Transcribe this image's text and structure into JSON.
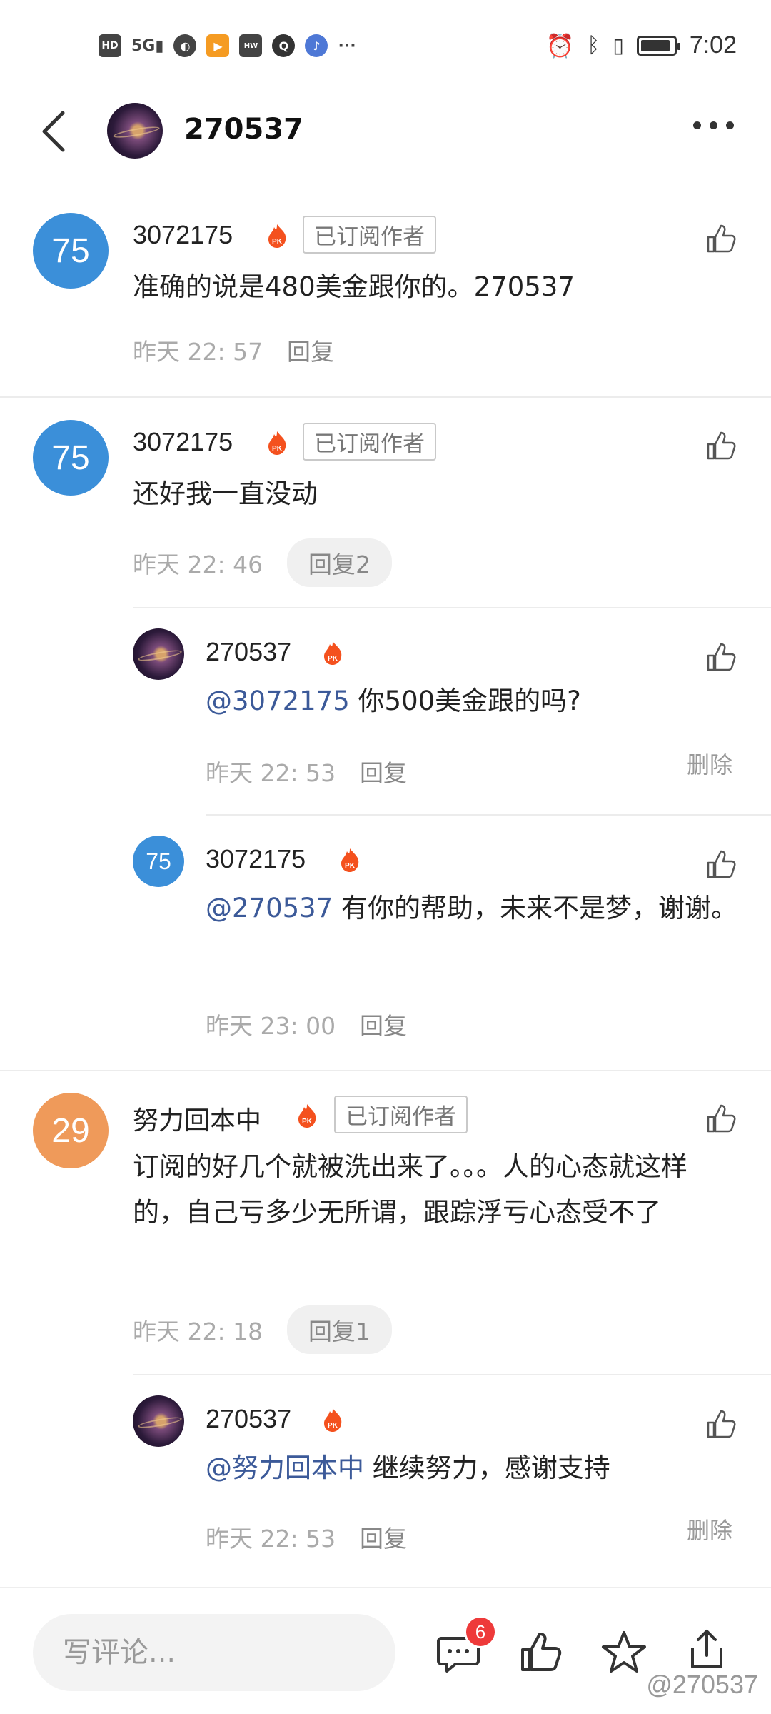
{
  "status_bar": {
    "left_icons": [
      "HD",
      "5G",
      "signal",
      "browser",
      "video",
      "huawei",
      "qq",
      "music",
      "..."
    ],
    "time": "7:02",
    "battery_level": 0.8
  },
  "header": {
    "title": "270537"
  },
  "comments": [
    {
      "avatar_label": "75",
      "avatar_color": "#3b8fd9",
      "username": "3072175",
      "badge": "已订阅作者",
      "text": "准确的说是480美金跟你的。270537",
      "time": "昨天 22: 57",
      "reply_label": "回复"
    },
    {
      "avatar_label": "75",
      "avatar_color": "#3b8fd9",
      "username": "3072175",
      "badge": "已订阅作者",
      "text": "还好我一直没动",
      "time": "昨天 22: 46",
      "reply_label": "回复2",
      "replies": [
        {
          "username": "270537",
          "mention": "@3072175",
          "text": " 你500美金跟的吗?",
          "time": "昨天 22: 53",
          "reply_label": "回复",
          "delete_label": "删除"
        },
        {
          "avatar_label": "75",
          "avatar_color": "#3b8fd9",
          "username": "3072175",
          "mention": "@270537",
          "text": " 有你的帮助，未来不是梦，谢谢。",
          "time": "昨天 23: 00",
          "reply_label": "回复"
        }
      ]
    },
    {
      "avatar_label": "29",
      "avatar_color": "#ef9a5a",
      "username": "努力回本中",
      "badge": "已订阅作者",
      "text": "订阅的好几个就被洗出来了。。。人的心态就这样的，自己亏多少无所谓，跟踪浮亏心态受不了",
      "time": "昨天 22: 18",
      "reply_label": "回复1",
      "replies": [
        {
          "username": "270537",
          "mention": "@努力回本中",
          "text": " 继续努力，感谢支持",
          "time": "昨天 22: 53",
          "reply_label": "回复",
          "delete_label": "删除"
        }
      ]
    }
  ],
  "bottom_bar": {
    "input_placeholder": "写评论...",
    "comment_count": "6",
    "watermark": "@270537"
  }
}
